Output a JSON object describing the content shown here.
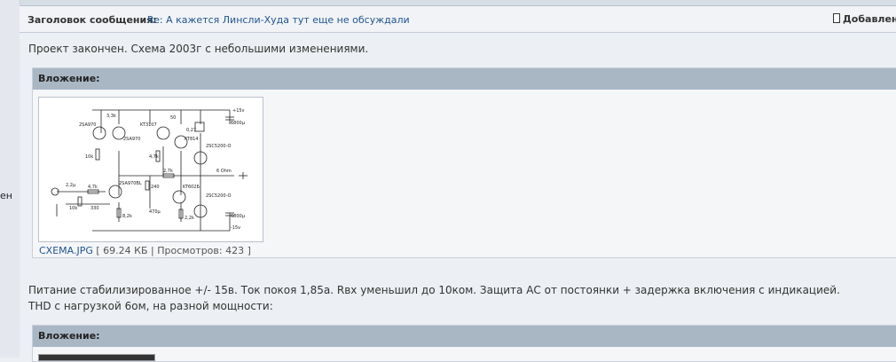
{
  "sidebar": {
    "partial_text": "ен"
  },
  "header": {
    "subject_label": "Заголовок сообщения:",
    "subject_link": "Re: А кажется Линсли-Худа тут еще не обсуждали",
    "posted_label": "Добавлено"
  },
  "post": {
    "line1": "Проект закончен. Схема 2003г с небольшими изменениями.",
    "line2": "Питание стабилизированное +/- 15в. Ток покоя 1,85а. Rвх уменьшил до 10ком. Защита АС от постоянки + задержка включения с индикацией.",
    "line3": "THD с нагрузкой 6ом, на разной мощности:"
  },
  "attachment1": {
    "header": "Вложение:",
    "filename": "CXEMA.JPG",
    "size_text": "[ 69.24 КБ",
    "views_text": "| Просмотров: 423 ]",
    "schematic_labels": {
      "t1": "2SA970",
      "t2": "2SA970",
      "r1": "3,3k",
      "t3": "KT3107",
      "r2": "50",
      "vplus": "+15v",
      "cap1": "6800µ",
      "r3": "0,27",
      "t4": "KT814",
      "t5": "2SC5200-O",
      "r4": "10k",
      "r5": "4,7k",
      "r6": "2,7k",
      "out": "6 Ohm",
      "c_in": "2,2µ",
      "r7": "4,7k",
      "t6": "2SA970BL",
      "r8": "240",
      "t7": "KT602Б",
      "t8": "2SC5200-O",
      "r9": "10k",
      "r10": "330",
      "c2": "470µ",
      "r11": "8,2k",
      "r12": "2,2k",
      "cap2": "6800µ",
      "vminus": "-15v"
    }
  },
  "attachment2": {
    "header": "Вложение:"
  }
}
